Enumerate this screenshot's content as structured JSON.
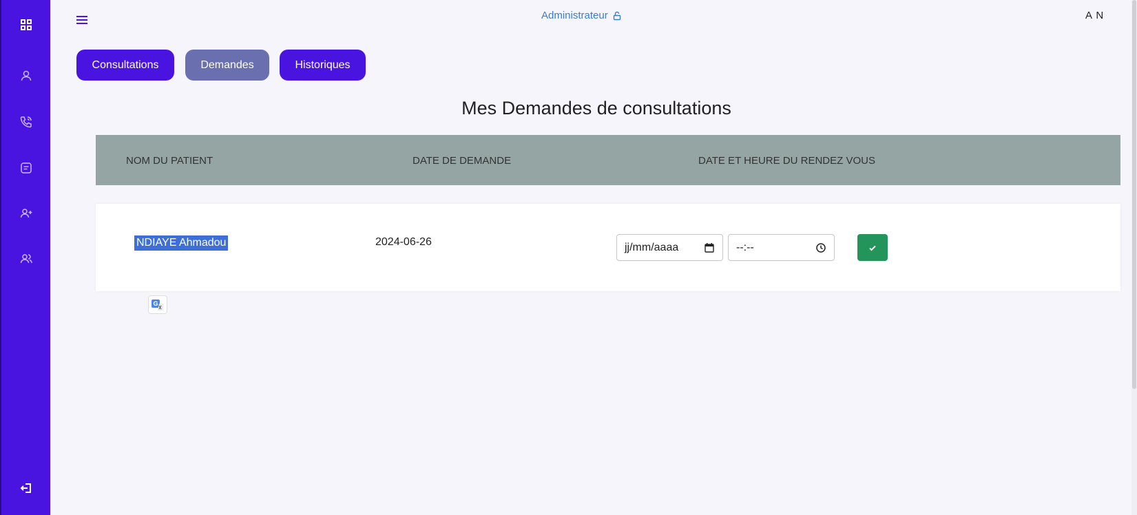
{
  "header": {
    "role_label": "Administrateur",
    "user_initials": "A N"
  },
  "sidebar": {
    "icons": [
      "dashboard-icon",
      "user-icon",
      "phone-icon",
      "message-icon",
      "add-user-icon",
      "users-icon",
      "logout-icon"
    ]
  },
  "tabs": [
    {
      "label": "Consultations"
    },
    {
      "label": "Demandes"
    },
    {
      "label": "Historiques"
    }
  ],
  "main": {
    "title": "Mes Demandes de consultations",
    "columns": [
      "NOM DU PATIENT",
      "DATE DE DEMANDE",
      "DATE ET HEURE DU RENDEZ VOUS"
    ],
    "rows": [
      {
        "patient": "NDIAYE Ahmadou",
        "date_demande": "2024-06-26",
        "date_placeholder": "jj/mm/aaaa",
        "time_placeholder": "--:--"
      }
    ]
  },
  "colors": {
    "accent": "#4a14e0",
    "active_tab": "#6a6fb0",
    "table_header": "#95a5a4",
    "confirm": "#23955a",
    "admin_link": "#3a7bd5"
  }
}
